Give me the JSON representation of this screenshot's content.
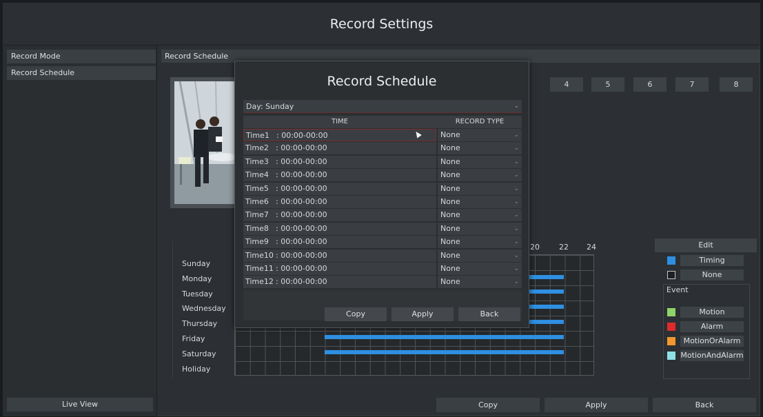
{
  "window_title": "Record Settings",
  "sidebar": {
    "items": [
      {
        "label": "Record Mode"
      },
      {
        "label": "Record Schedule"
      }
    ],
    "live_view_label": "Live View"
  },
  "main": {
    "header": "Record Schedule",
    "channels": [
      "4",
      "5",
      "6",
      "7",
      "8"
    ],
    "hours": [
      "20",
      "22",
      "24"
    ],
    "days": [
      "Sunday",
      "Monday",
      "Tuesday",
      "Wednesday",
      "Thursday",
      "Friday",
      "Saturday",
      "Holiday"
    ],
    "edit_label": "Edit",
    "legend": {
      "timing": "Timing",
      "none": "None",
      "event_heading": "Event",
      "motion": "Motion",
      "alarm": "Alarm",
      "motion_or_alarm": "MotionOrAlarm",
      "motion_and_alarm": "MotionAndAlarm"
    },
    "colors": {
      "timing": "#2f8fe2",
      "motion": "#8fd46a",
      "alarm": "#e02b2b",
      "motion_or_alarm": "#f2962e",
      "motion_and_alarm": "#8fe0e6"
    },
    "footer": {
      "copy": "Copy",
      "apply": "Apply",
      "back": "Back"
    }
  },
  "modal": {
    "title": "Record Schedule",
    "day_label": "Day:",
    "day_value": "Sunday",
    "col_time": "TIME",
    "col_type": "RECORD TYPE",
    "rows": [
      {
        "label": "Time1",
        "time": "00:00-00:00",
        "type": "None"
      },
      {
        "label": "Time2",
        "time": "00:00-00:00",
        "type": "None"
      },
      {
        "label": "Time3",
        "time": "00:00-00:00",
        "type": "None"
      },
      {
        "label": "Time4",
        "time": "00:00-00:00",
        "type": "None"
      },
      {
        "label": "Time5",
        "time": "00:00-00:00",
        "type": "None"
      },
      {
        "label": "Time6",
        "time": "00:00-00:00",
        "type": "None"
      },
      {
        "label": "Time7",
        "time": "00:00-00:00",
        "type": "None"
      },
      {
        "label": "Time8",
        "time": "00:00-00:00",
        "type": "None"
      },
      {
        "label": "Time9",
        "time": "00:00-00:00",
        "type": "None"
      },
      {
        "label": "Time10",
        "time": "00:00-00:00",
        "type": "None"
      },
      {
        "label": "Time11",
        "time": "00:00-00:00",
        "type": "None"
      },
      {
        "label": "Time12",
        "time": "00:00-00:00",
        "type": "None"
      }
    ],
    "copy": "Copy",
    "apply": "Apply",
    "back": "Back"
  }
}
